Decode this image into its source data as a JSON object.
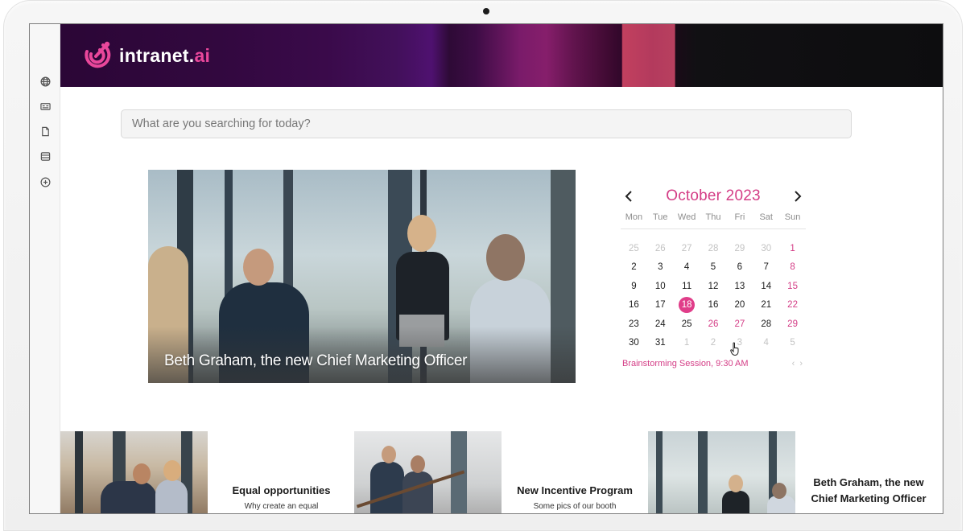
{
  "brand": {
    "name_main": "intranet.",
    "name_accent": "ai",
    "accent_color": "#e9479b",
    "logo_icon": "target-dart-icon"
  },
  "sidebar": {
    "items": [
      {
        "icon": "globe-icon",
        "label": "Web"
      },
      {
        "icon": "id-card-icon",
        "label": "Directory"
      },
      {
        "icon": "document-icon",
        "label": "Documents"
      },
      {
        "icon": "database-icon",
        "label": "Data"
      },
      {
        "icon": "add-circle-icon",
        "label": "Add"
      }
    ]
  },
  "search": {
    "placeholder": "What are you searching for today?",
    "value": ""
  },
  "hero": {
    "caption": "Beth Graham, the new Chief Marketing Officer"
  },
  "calendar": {
    "title": "October 2023",
    "prev_icon": "chevron-left-icon",
    "next_icon": "chevron-right-icon",
    "weekdays": [
      "Mon",
      "Tue",
      "Wed",
      "Thu",
      "Fri",
      "Sat",
      "Sun"
    ],
    "today": "18",
    "accent_color": "#d43d86",
    "weeks": [
      [
        {
          "d": "25",
          "s": "muted"
        },
        {
          "d": "26",
          "s": "muted"
        },
        {
          "d": "27",
          "s": "muted"
        },
        {
          "d": "28",
          "s": "muted"
        },
        {
          "d": "29",
          "s": "muted"
        },
        {
          "d": "30",
          "s": "muted"
        },
        {
          "d": "1",
          "s": "pink"
        }
      ],
      [
        {
          "d": "2",
          "s": ""
        },
        {
          "d": "3",
          "s": ""
        },
        {
          "d": "4",
          "s": ""
        },
        {
          "d": "5",
          "s": ""
        },
        {
          "d": "6",
          "s": ""
        },
        {
          "d": "7",
          "s": ""
        },
        {
          "d": "8",
          "s": "pink"
        }
      ],
      [
        {
          "d": "9",
          "s": ""
        },
        {
          "d": "10",
          "s": ""
        },
        {
          "d": "11",
          "s": ""
        },
        {
          "d": "12",
          "s": ""
        },
        {
          "d": "13",
          "s": ""
        },
        {
          "d": "14",
          "s": ""
        },
        {
          "d": "15",
          "s": "pink"
        }
      ],
      [
        {
          "d": "16",
          "s": ""
        },
        {
          "d": "17",
          "s": ""
        },
        {
          "d": "18",
          "s": "today"
        },
        {
          "d": "16",
          "s": ""
        },
        {
          "d": "20",
          "s": ""
        },
        {
          "d": "21",
          "s": ""
        },
        {
          "d": "22",
          "s": "pink"
        }
      ],
      [
        {
          "d": "23",
          "s": ""
        },
        {
          "d": "24",
          "s": ""
        },
        {
          "d": "25",
          "s": ""
        },
        {
          "d": "26",
          "s": "pink"
        },
        {
          "d": "27",
          "s": "pink"
        },
        {
          "d": "28",
          "s": ""
        },
        {
          "d": "29",
          "s": "pink"
        }
      ],
      [
        {
          "d": "30",
          "s": ""
        },
        {
          "d": "31",
          "s": ""
        },
        {
          "d": "1",
          "s": "muted"
        },
        {
          "d": "2",
          "s": "muted"
        },
        {
          "d": "3",
          "s": "muted"
        },
        {
          "d": "4",
          "s": "muted"
        },
        {
          "d": "5",
          "s": "muted"
        }
      ]
    ],
    "event": {
      "text": "Brainstorming Session, 9:30 AM",
      "prev": "‹",
      "next": "›"
    }
  },
  "news": [
    {
      "title": "Equal opportunities",
      "snippet": "Why create an equal"
    },
    {
      "title": "New Incentive Program",
      "snippet": "Some pics of our booth"
    },
    {
      "title": "Beth Graham, the new Chief Marketing Officer",
      "snippet": ""
    }
  ]
}
